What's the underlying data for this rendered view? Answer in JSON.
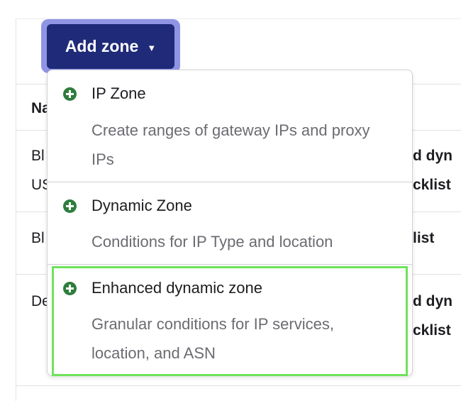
{
  "toolbar": {
    "add_zone_label": "Add zone",
    "caret": "▼"
  },
  "table": {
    "header_fragment": "Na",
    "rows": [
      {
        "left_lines": [
          "Bl",
          "US"
        ],
        "right_lines": [
          "d dyn",
          "cklist"
        ]
      },
      {
        "left_lines": [
          "Bl"
        ],
        "right_lines": [
          "list"
        ]
      },
      {
        "left_lines": [
          "De"
        ],
        "right_lines": [
          "d dyn",
          "cklist"
        ]
      }
    ]
  },
  "dropdown": {
    "items": [
      {
        "icon": "plus-circle-icon",
        "title": "IP Zone",
        "description": "Create ranges of gateway IPs and proxy IPs"
      },
      {
        "icon": "plus-circle-icon",
        "title": "Dynamic Zone",
        "description": "Conditions for IP Type and location"
      },
      {
        "icon": "plus-circle-icon",
        "title": "Enhanced dynamic zone",
        "description": "Granular conditions for IP services, location, and ASN"
      }
    ]
  },
  "colors": {
    "button_bg": "#1f2a78",
    "button_focus_ring": "#8f95e4",
    "plus_icon": "#2e7d3c",
    "highlight": "#6fe35a",
    "description_text": "#6b6b72"
  }
}
